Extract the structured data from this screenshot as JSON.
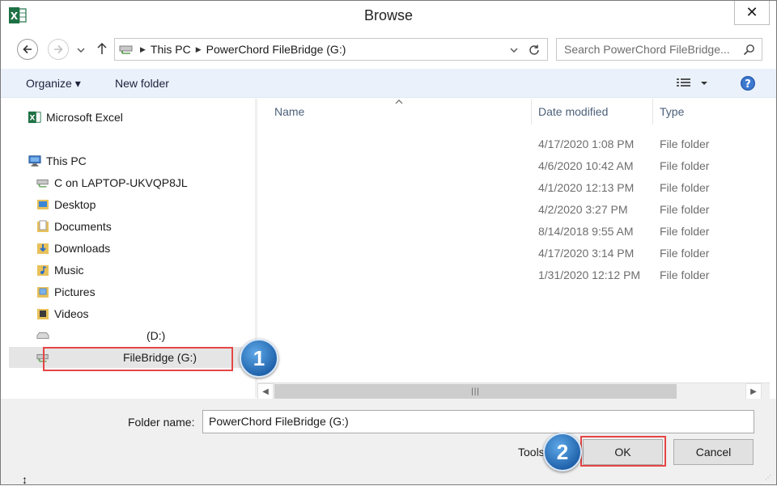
{
  "window": {
    "title": "Browse",
    "app_icon": "excel-icon",
    "close_glyph": "✕"
  },
  "address": {
    "crumbs": [
      "This PC",
      "PowerChord FileBridge (G:)"
    ],
    "search_placeholder": "Search PowerChord FileBridge..."
  },
  "commands": {
    "organize": "Organize ▾",
    "new_folder": "New folder"
  },
  "nav": {
    "quick": "Microsoft Excel",
    "this_pc": "This PC",
    "items": [
      {
        "label": "C on LAPTOP-UKVQP8JL",
        "icon": "network-drive-icon"
      },
      {
        "label": "Desktop",
        "icon": "desktop-folder-icon"
      },
      {
        "label": "Documents",
        "icon": "documents-folder-icon"
      },
      {
        "label": "Downloads",
        "icon": "downloads-folder-icon"
      },
      {
        "label": "Music",
        "icon": "music-folder-icon"
      },
      {
        "label": "Pictures",
        "icon": "pictures-folder-icon"
      },
      {
        "label": "Videos",
        "icon": "videos-folder-icon"
      },
      {
        "label": "(D:)",
        "icon": "drive-icon"
      },
      {
        "label": "FileBridge (G:)",
        "icon": "network-drive-icon"
      }
    ]
  },
  "columns": {
    "name": "Name",
    "date": "Date modified",
    "type": "Type"
  },
  "rows": [
    {
      "date": "4/17/2020 1:08 PM",
      "type": "File folder"
    },
    {
      "date": "4/6/2020 10:42 AM",
      "type": "File folder"
    },
    {
      "date": "4/1/2020 12:13 PM",
      "type": "File folder"
    },
    {
      "date": "4/2/2020 3:27 PM",
      "type": "File folder"
    },
    {
      "date": "8/14/2018 9:55 AM",
      "type": "File folder"
    },
    {
      "date": "4/17/2020 3:14 PM",
      "type": "File folder"
    },
    {
      "date": "1/31/2020 12:12 PM",
      "type": "File folder"
    }
  ],
  "footer": {
    "folder_name_label": "Folder name:",
    "folder_name_value": "PowerChord FileBridge (G:)",
    "tools_label": "Tools",
    "ok_label": "OK",
    "cancel_label": "Cancel"
  },
  "callouts": {
    "step1": "1",
    "step2": "2",
    "color": "#e64545",
    "badge_color": "#2a70bd"
  }
}
